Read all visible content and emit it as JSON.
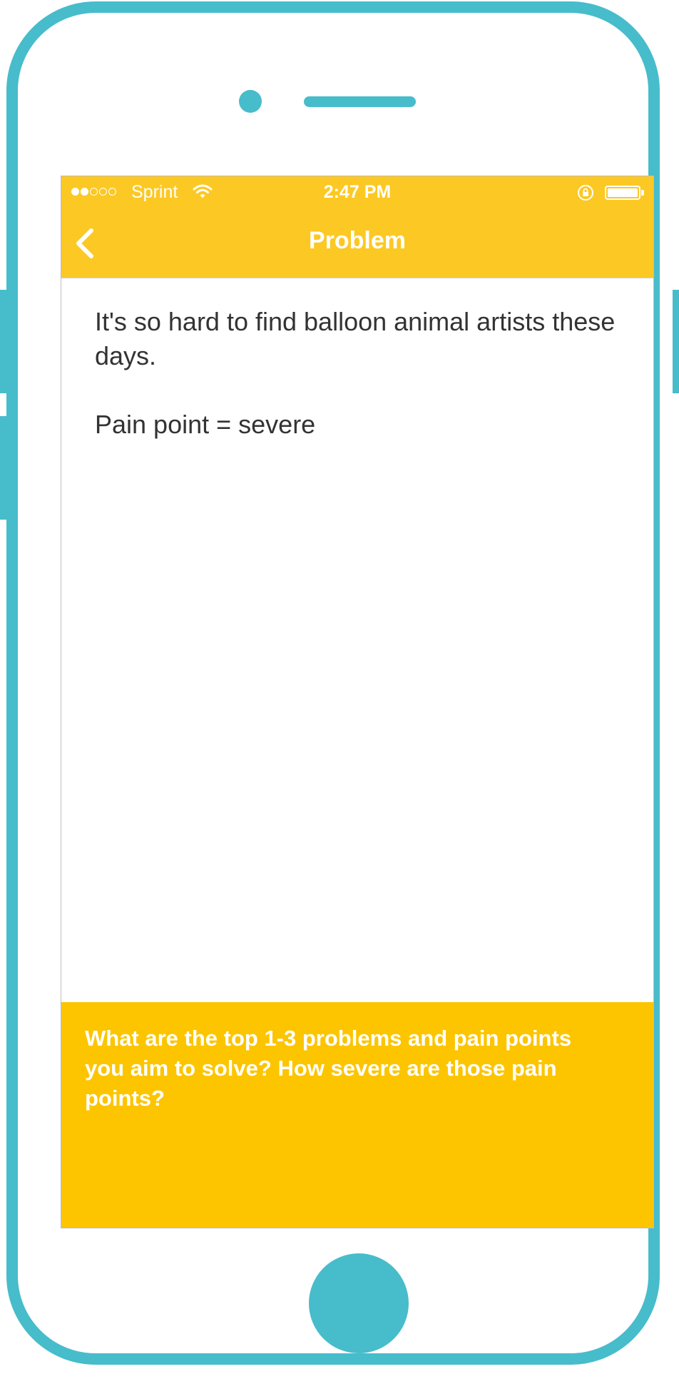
{
  "status_bar": {
    "carrier": "Sprint",
    "time": "2:47 PM",
    "signal_bars_filled": 2,
    "signal_bars_total": 5,
    "icons": [
      "wifi-icon",
      "orientation-lock-icon",
      "battery-icon"
    ]
  },
  "nav": {
    "title": "Problem",
    "back_icon": "chevron-left-icon"
  },
  "content": {
    "line1": "It's so hard to find balloon animal artists these days.",
    "line2": "Pain point = severe"
  },
  "prompt": {
    "text": "What are the top 1-3 problems and pain points you aim to solve? How severe are those pain points?"
  },
  "colors": {
    "frame": "#47bccb",
    "header": "#fcc823",
    "prompt_panel": "#fcc500",
    "body_text": "#333333"
  }
}
